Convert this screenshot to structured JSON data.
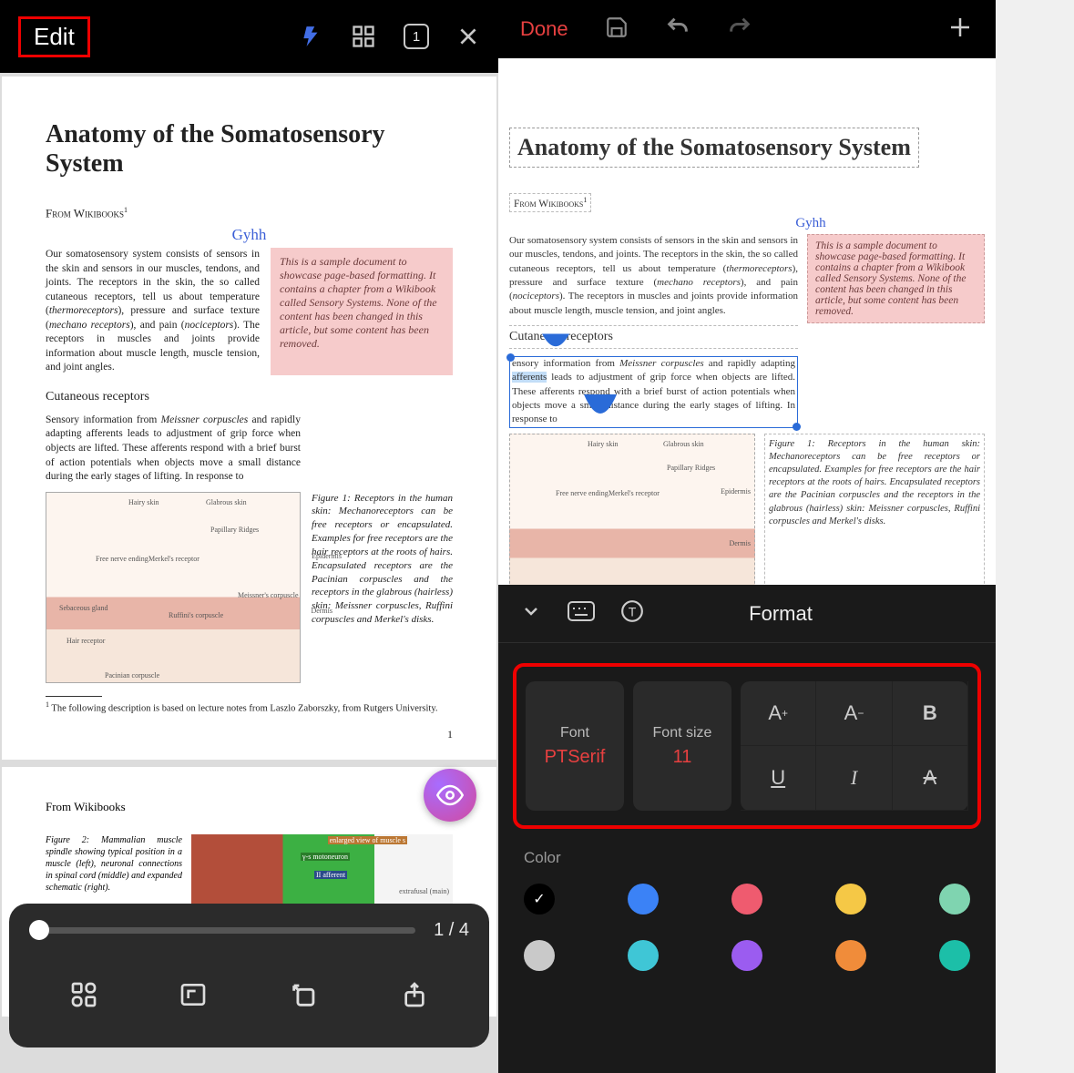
{
  "left": {
    "topbar": {
      "edit": "Edit",
      "tab_count": "1"
    },
    "doc": {
      "title": "Anatomy of the Somatosensory System",
      "source": "From Wikibooks",
      "source_sup": "1",
      "annotation": "Gyhh",
      "para1a": "Our somatosensory system consists of sensors in the skin and sensors in our muscles, tendons, and joints. The receptors in the skin, the so called cutaneous receptors, tell us about temperature (",
      "thermo": "thermoreceptors",
      "para1b": "), pressure and surface texture (",
      "mechano": "mechano receptors",
      "para1c": "), and pain (",
      "noci": "nociceptors",
      "para1d": "). The receptors in muscles and joints provide information about muscle length, muscle tension, and joint angles.",
      "callout": "This is a sample document to showcase page-based formatting. It contains a chapter from a Wikibook called Sensory Systems. None of the content has been changed in this article, but some content has been removed.",
      "subhead": "Cutaneous receptors",
      "para2a": "Sensory information from ",
      "meissner": "Meissner corpuscles",
      "para2b": " and rapidly adapting afferents leads to adjustment of grip force when objects are lifted. These afferents respond with a brief burst of action potentials when objects move a small distance during the early stages of lifting. In response to",
      "fig1": "Figure 1:  Receptors in the human skin: Mechanoreceptors can be free receptors or encapsulated. Examples for free receptors are the hair receptors at the roots of hairs. Encapsulated receptors are the Pacinian corpuscles and the receptors in the glabrous (hairless) skin: Meissner corpuscles, Ruffini corpuscles and Merkel's disks.",
      "footnote": " The following description is based on lecture notes from Laszlo Zaborszky, from Rutgers University.",
      "pagenum": "1",
      "labels": {
        "hairy": "Hairy skin",
        "glabrous": "Glabrous skin",
        "epidermis": "Epidermis",
        "dermis": "Dermis",
        "papillary": "Papillary Ridges",
        "freenerve": "Free nerve ending",
        "merkel": "Merkel's receptor",
        "meissner_c": "Meissner's corpuscle",
        "ruffini": "Ruffini's corpuscle",
        "sebaceous": "Sebaceous gland",
        "hairrec": "Hair receptor",
        "pacinian": "Pacinian corpuscle"
      }
    },
    "doc2": {
      "source": "From Wikibooks",
      "fig2": "Figure 2:  Mammalian muscle spindle showing typical position in a muscle (left), neuronal connections in spinal cord (middle) and expanded schematic (right).",
      "figlabel1": "enlarged view of muscle s",
      "figlabel2": "γ-s motoneuron",
      "figlabel3": "II afferent",
      "figlabel4": "extrafusal (main)"
    },
    "bottom": {
      "pages": "1 / 4"
    }
  },
  "right": {
    "topbar": {
      "done": "Done"
    },
    "doc": {
      "title": "Anatomy of the Somatosensory System",
      "source": "From Wikibooks",
      "source_sup": "1",
      "annotation": "Gyhh",
      "para1a": "Our somatosensory system consists of sensors in the skin and sensors in our muscles, tendons, and joints. The receptors in the skin, the so called cutaneous receptors, tell us about temperature (",
      "thermo": "thermoreceptors",
      "para1b": "), pressure and surface texture (",
      "mechano": "mechano receptors",
      "para1c": "), and pain (",
      "noci": "nociceptors",
      "para1d": "). The receptors in muscles and joints provide information about muscle length, muscle tension, and joint angles.",
      "subhead": "Cutaneous receptors",
      "sel1": "ensory information from ",
      "meissner": "Meissner corpuscles",
      "sel2": " and rapidly adapting ",
      "afferents": "afferents",
      "sel3": " leads to adjustment of grip force when objects are lifted. These afferents respond with a brief burst of action potentials when objects move a small distance during the early stages of lifting. In response to",
      "callout": "This is a sample document to showcase page-based formatting. It contains a chapter from a Wikibook called Sensory Systems. None of the content has been changed in this article, but some content has been removed.",
      "fig1": "Figure 1:  Receptors in the human skin: Mechanoreceptors can be free receptors or encapsulated. Examples for free receptors are the hair receptors at the roots of hairs. Encapsulated receptors are the Pacinian corpuscles and the receptors in the glabrous (hairless) skin: Meissner corpuscles, Ruffini corpuscles and Merkel's disks."
    },
    "format": {
      "title": "Format",
      "font_label": "Font",
      "font_value": "PTSerif",
      "size_label": "Font size",
      "size_value": "11",
      "color_label": "Color",
      "colors_row1": [
        "#000000",
        "#3b82f6",
        "#ef5b6f",
        "#f5c846",
        "#7fd4b0"
      ],
      "colors_row2": [
        "#c9c9c9",
        "#3fc6d6",
        "#9b5cf0",
        "#f08c3a",
        "#1cbfa8"
      ],
      "selected_color_index": 0
    }
  }
}
